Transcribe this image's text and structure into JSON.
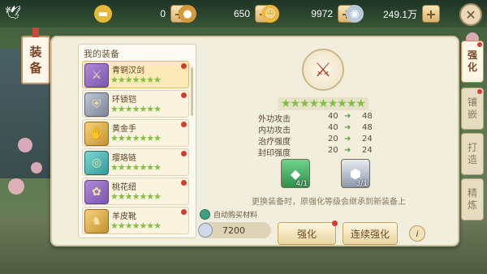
{
  "resources": [
    {
      "icon": "gold-ingot-icon",
      "value": "0",
      "color": "#e7b93a"
    },
    {
      "icon": "copper-coin-icon",
      "value": "650",
      "color": "#d49a3a"
    },
    {
      "icon": "face-coin-icon",
      "value": "9972",
      "color": "#f0b640"
    },
    {
      "icon": "silver-coin-icon",
      "value": "249.1万",
      "color": "#b9c7d9"
    }
  ],
  "side_banner": {
    "line1": "装",
    "line2": "备"
  },
  "equipment_list": {
    "title": "我的装备",
    "items": [
      {
        "name": "青铜汉剑",
        "stars": "★★★★★★★",
        "thumb": "purple",
        "glyph": "⚔"
      },
      {
        "name": "环锁铠",
        "stars": "★★★★★★★",
        "thumb": "grey",
        "glyph": "⛨"
      },
      {
        "name": "黄金手",
        "stars": "★★★★★★★",
        "thumb": "gold",
        "glyph": "✋"
      },
      {
        "name": "璎珞链",
        "stars": "★★★★★★★",
        "thumb": "teal",
        "glyph": "◎"
      },
      {
        "name": "桃花纽",
        "stars": "★★★★★★★",
        "thumb": "purple",
        "glyph": "✿"
      },
      {
        "name": "羊皮靴",
        "stars": "★★★★★★★",
        "thumb": "gold",
        "glyph": "♞"
      }
    ]
  },
  "detail": {
    "stars": "★★★★★★★★★",
    "stats": [
      {
        "label": "外功攻击",
        "from": "40",
        "to": "48"
      },
      {
        "label": "内功攻击",
        "from": "40",
        "to": "48"
      },
      {
        "label": "治疗强度",
        "from": "20",
        "to": "24"
      },
      {
        "label": "封印强度",
        "from": "20",
        "to": "24"
      }
    ],
    "materials": [
      {
        "count": "4/1",
        "icon": "green-crystal-icon",
        "color": "#3fae5a"
      },
      {
        "count": "3/1",
        "icon": "silver-ore-icon",
        "color": "#9aa6b5"
      }
    ],
    "hint": "更换装备时，原强化等级会继承到新装备上",
    "auto_buy_label": "自动购买材料",
    "cost": "7200",
    "enhance_label": "强化",
    "continuous_enhance_label": "连续强化",
    "info_label": "i"
  },
  "tabs": [
    {
      "line1": "强",
      "line2": "化",
      "active": true
    },
    {
      "line1": "镶",
      "line2": "嵌",
      "active": false
    },
    {
      "line1": "打",
      "line2": "造",
      "active": false
    },
    {
      "line1": "精",
      "line2": "炼",
      "active": false
    }
  ],
  "close_label": "✕"
}
